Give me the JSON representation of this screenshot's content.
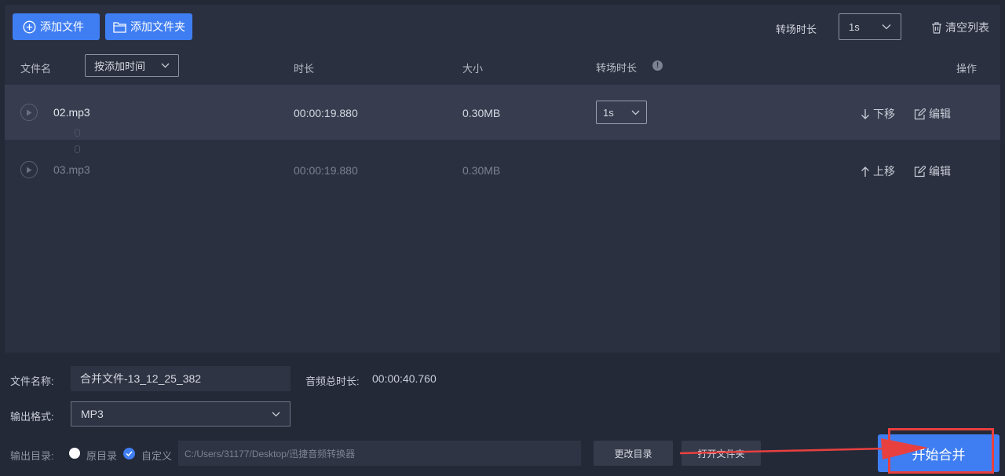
{
  "toolbar": {
    "add_file_label": "添加文件",
    "add_folder_label": "添加文件夹",
    "transition_label": "转场时长",
    "transition_value": "1s",
    "clear_list_label": "清空列表"
  },
  "table": {
    "col_name": "文件名",
    "sort_value": "按添加时间",
    "col_duration": "时长",
    "col_size": "大小",
    "col_transition": "转场时长",
    "col_action": "操作",
    "rows": [
      {
        "name": "02.mp3",
        "duration": "00:00:19.880",
        "size": "0.30MB",
        "transition": "1s",
        "move_label": "下移",
        "edit_label": "编辑"
      },
      {
        "name": "03.mp3",
        "duration": "00:00:19.880",
        "size": "0.30MB",
        "move_label": "上移",
        "edit_label": "编辑"
      }
    ]
  },
  "bottom": {
    "filename_label": "文件名称:",
    "filename_value": "合并文件-13_12_25_382",
    "total_duration_label": "音频总时长:",
    "total_duration_value": "00:00:40.760",
    "format_label": "输出格式:",
    "format_value": "MP3",
    "output_dir_label": "输出目录:",
    "option_original": "原目录",
    "option_custom": "自定义",
    "path_value": "C:/Users/31177/Desktop/迅捷音频转换器",
    "change_dir_label": "更改目录",
    "open_folder_label": "打开文件夹",
    "start_label": "开始合并"
  },
  "colors": {
    "accent": "#3f7ef2",
    "annotation": "#e8403f",
    "background": "#242938",
    "panel": "#2b3040"
  }
}
